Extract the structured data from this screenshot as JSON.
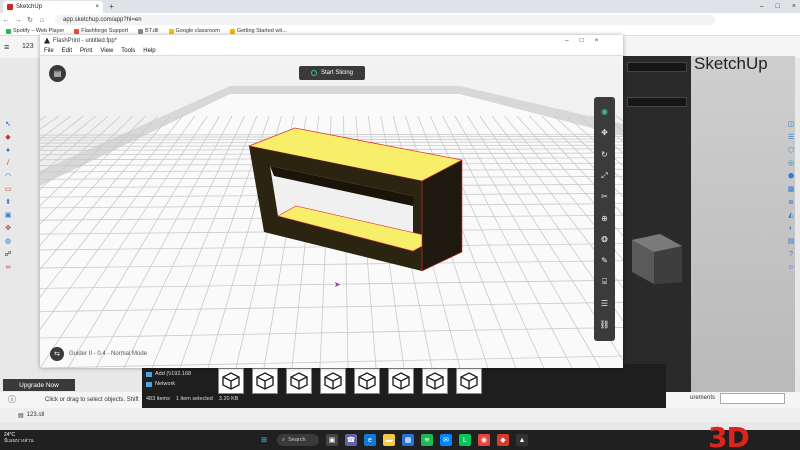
{
  "browser": {
    "tab_title": "SketchUp",
    "new_tab": "+",
    "url": "app.sketchup.com/app?hl=en",
    "bookmarks": [
      "Spotify – Web Player",
      "Flashforge Support",
      "BT.dll",
      "Google classroom",
      "Getting Started wit..."
    ]
  },
  "sketchup": {
    "logo_text": "SketchUp",
    "file_number": "123",
    "upgrade_label": "Upgrade Now",
    "status_hint": "Click or drag to select objects. Shift",
    "measurements_label": "urements",
    "file_name": "123.stl"
  },
  "explorer": {
    "nav_items": [
      "Add (\\\\192.168",
      "Network"
    ],
    "status": [
      "483 items",
      "1 item selected",
      "3.20 KB"
    ],
    "thumb_count": 8
  },
  "flashprint": {
    "title": "FlashPrint - untitled.fpp*",
    "menu": [
      "File",
      "Edit",
      "Print",
      "View",
      "Tools",
      "Help"
    ],
    "start_slicing_label": "Start Slicing",
    "status_text": "Guider II - 0.4 - Normal Mode",
    "tools": [
      "eye-icon",
      "move-icon",
      "rotate-icon",
      "scale-icon",
      "cut-icon",
      "support-icon",
      "color-icon",
      "brush-icon",
      "cylinder-icon",
      "settings-icon",
      "link-icon"
    ]
  },
  "taskbar": {
    "weather_temp": "24°C",
    "weather_desc": "มีเมฆบางส่วน",
    "search_label": "Search"
  },
  "watermark": "3D",
  "colors": {
    "model_yellow": "#f7ef6a",
    "model_dark": "#1f1a10",
    "accent_teal": "#35c7a0",
    "brand_red": "#e0231c"
  }
}
